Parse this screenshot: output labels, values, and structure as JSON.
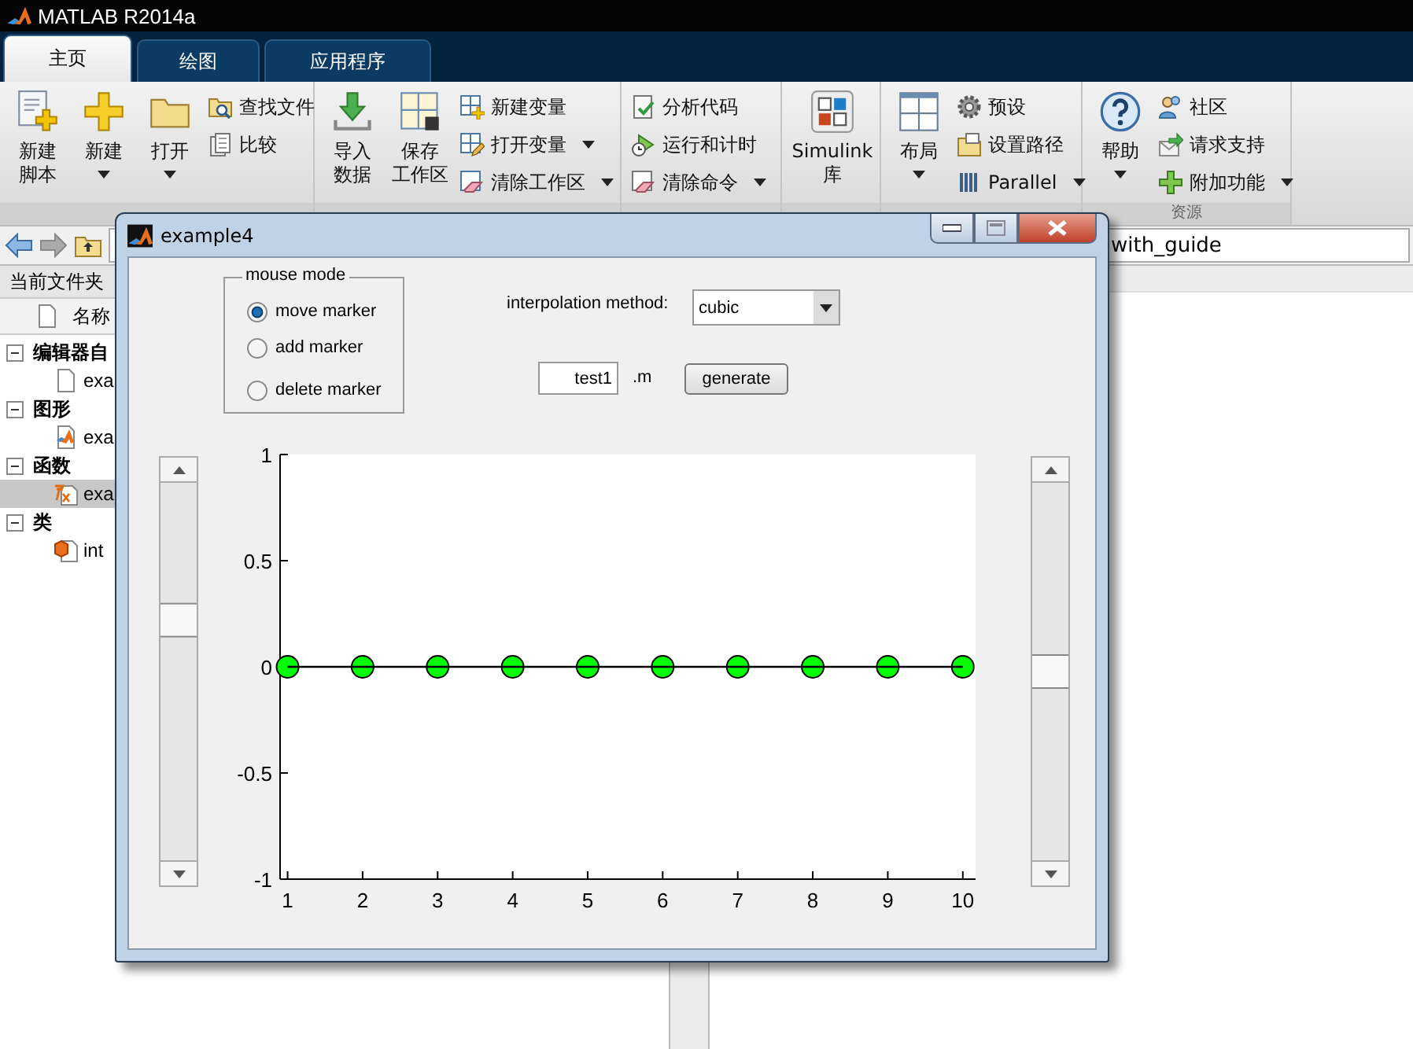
{
  "window": {
    "title": "MATLAB R2014a"
  },
  "tabs": [
    {
      "label": "主页",
      "selected": true
    },
    {
      "label": "绘图",
      "selected": false
    },
    {
      "label": "应用程序",
      "selected": false
    }
  ],
  "ribbon": {
    "groups": [
      {
        "items": [
          {
            "kind": "large",
            "label": [
              "新建",
              "脚本"
            ],
            "dropdown": false
          },
          {
            "kind": "large",
            "label": [
              "新建"
            ],
            "dropdown": true
          },
          {
            "kind": "large",
            "label": [
              "打开"
            ],
            "dropdown": true
          },
          {
            "kind": "small",
            "entries": [
              {
                "label": "查找文件",
                "dropdown": false
              },
              {
                "label": "比较",
                "dropdown": false
              }
            ]
          }
        ]
      },
      {
        "items": [
          {
            "kind": "large",
            "label": [
              "导入",
              "数据"
            ],
            "dropdown": false
          },
          {
            "kind": "large",
            "label": [
              "保存",
              "工作区"
            ],
            "dropdown": false
          },
          {
            "kind": "small",
            "entries": [
              {
                "label": "新建变量",
                "dropdown": false
              },
              {
                "label": "打开变量",
                "dropdown": true
              },
              {
                "label": "清除工作区",
                "dropdown": true
              }
            ]
          }
        ]
      },
      {
        "items": [
          {
            "kind": "small",
            "entries": [
              {
                "label": "分析代码",
                "dropdown": false
              },
              {
                "label": "运行和计时",
                "dropdown": false
              },
              {
                "label": "清除命令",
                "dropdown": true
              }
            ]
          }
        ]
      },
      {
        "items": [
          {
            "kind": "large",
            "label": [
              "Simulink",
              "库"
            ],
            "dropdown": false
          }
        ]
      },
      {
        "items": [
          {
            "kind": "large",
            "label": [
              "布局"
            ],
            "dropdown": true
          },
          {
            "kind": "small",
            "entries": [
              {
                "label": "预设",
                "dropdown": false
              },
              {
                "label": "设置路径",
                "dropdown": false
              },
              {
                "label": "Parallel",
                "dropdown": true
              }
            ]
          }
        ]
      },
      {
        "label": "资源",
        "items": [
          {
            "kind": "large",
            "label": [
              "帮助"
            ],
            "dropdown": true
          },
          {
            "kind": "small",
            "entries": [
              {
                "label": "社区",
                "dropdown": false
              },
              {
                "label": "请求支持",
                "dropdown": false
              },
              {
                "label": "附加功能",
                "dropdown": true
              }
            ]
          }
        ]
      }
    ]
  },
  "address_bar": {
    "path": "with_guide"
  },
  "current_folder": {
    "title": "当前文件夹",
    "column": "名称",
    "tree": [
      {
        "label": "编辑器自",
        "expanded": true,
        "selected": false,
        "children": [
          {
            "label": "exa",
            "selected": false
          }
        ]
      },
      {
        "label": "图形",
        "expanded": true,
        "selected": false,
        "children": [
          {
            "label": "exa",
            "selected": false
          }
        ]
      },
      {
        "label": "函数",
        "expanded": true,
        "selected": false,
        "children": [
          {
            "label": "exa",
            "selected": true
          }
        ]
      },
      {
        "label": "类",
        "expanded": true,
        "selected": false,
        "children": [
          {
            "label": "int",
            "selected": false
          }
        ]
      }
    ]
  },
  "dialog": {
    "title": "example4",
    "mouse_mode": {
      "title": "mouse mode",
      "options": [
        {
          "label": "move marker",
          "selected": true
        },
        {
          "label": "add marker",
          "selected": false
        },
        {
          "label": "delete marker",
          "selected": false
        }
      ]
    },
    "interpolation": {
      "label": "interpolation method:",
      "value": "cubic"
    },
    "file": {
      "value": "test1",
      "extension": ".m"
    },
    "generate_button": "generate",
    "sliders": [
      {
        "level": 0.65
      },
      {
        "level": 0.5
      }
    ],
    "chart_data": {
      "type": "line",
      "x": [
        1,
        2,
        3,
        4,
        5,
        6,
        7,
        8,
        9,
        10
      ],
      "series": [
        {
          "color": "#00ff00",
          "marker": "circle",
          "values": [
            0,
            0,
            0,
            0,
            0,
            0,
            0,
            0,
            0,
            0
          ]
        }
      ],
      "xlim": [
        0.9,
        10.17
      ],
      "ylim": [
        -1,
        1
      ],
      "xticks": [
        1,
        2,
        3,
        4,
        5,
        6,
        7,
        8,
        9,
        10
      ],
      "yticks": [
        -1,
        -0.5,
        0,
        0.5,
        1
      ]
    }
  }
}
